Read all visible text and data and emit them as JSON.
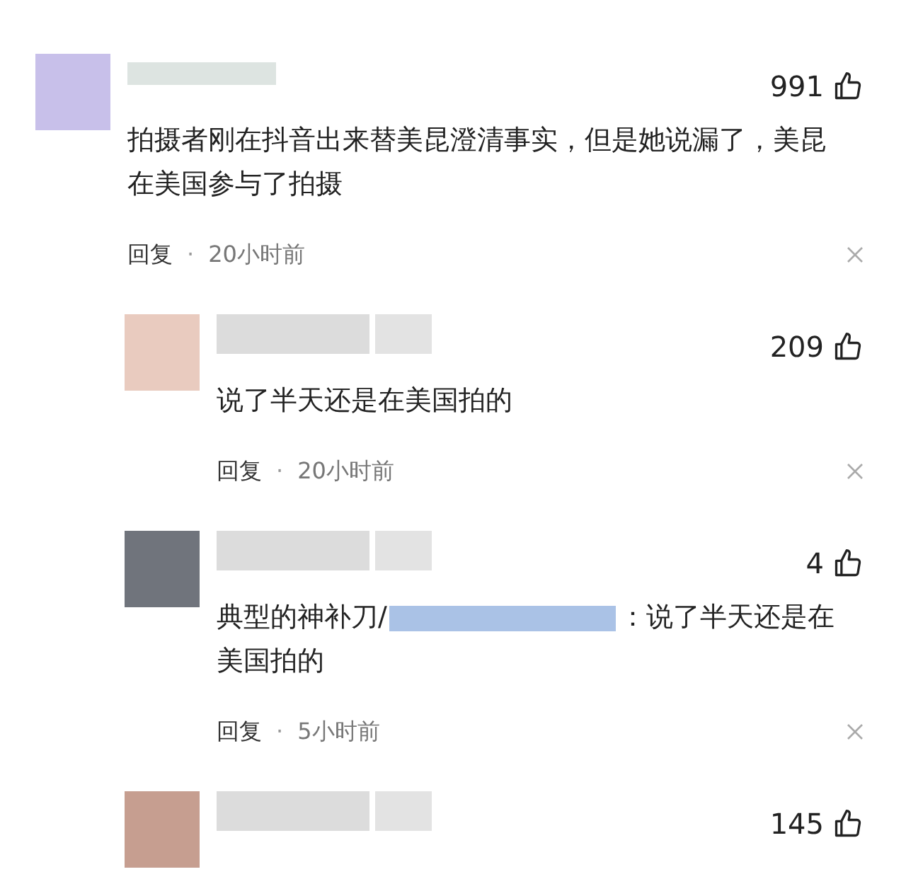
{
  "comments": [
    {
      "color": "#c8c0ea",
      "likes": "991",
      "text": "拍摄者刚在抖音出来替美昆澄清事实，但是她说漏了，美昆在美国参与了拍摄",
      "reply": "回复",
      "dot": "·",
      "time": "20小时前",
      "children": [
        {
          "color": "#e9cbbf",
          "likes": "209",
          "text_parts": [
            "说了半天还是在美国拍的"
          ],
          "reply": "回复",
          "dot": "·",
          "time": "20小时前"
        },
        {
          "color": "#70747c",
          "likes": "4",
          "text_parts": [
            "典型的神补刀/",
            "：说了半天还是在美国拍的"
          ],
          "reply": "回复",
          "dot": "·",
          "time": "5小时前"
        },
        {
          "color": "#c69e90",
          "likes": "145"
        }
      ]
    }
  ]
}
